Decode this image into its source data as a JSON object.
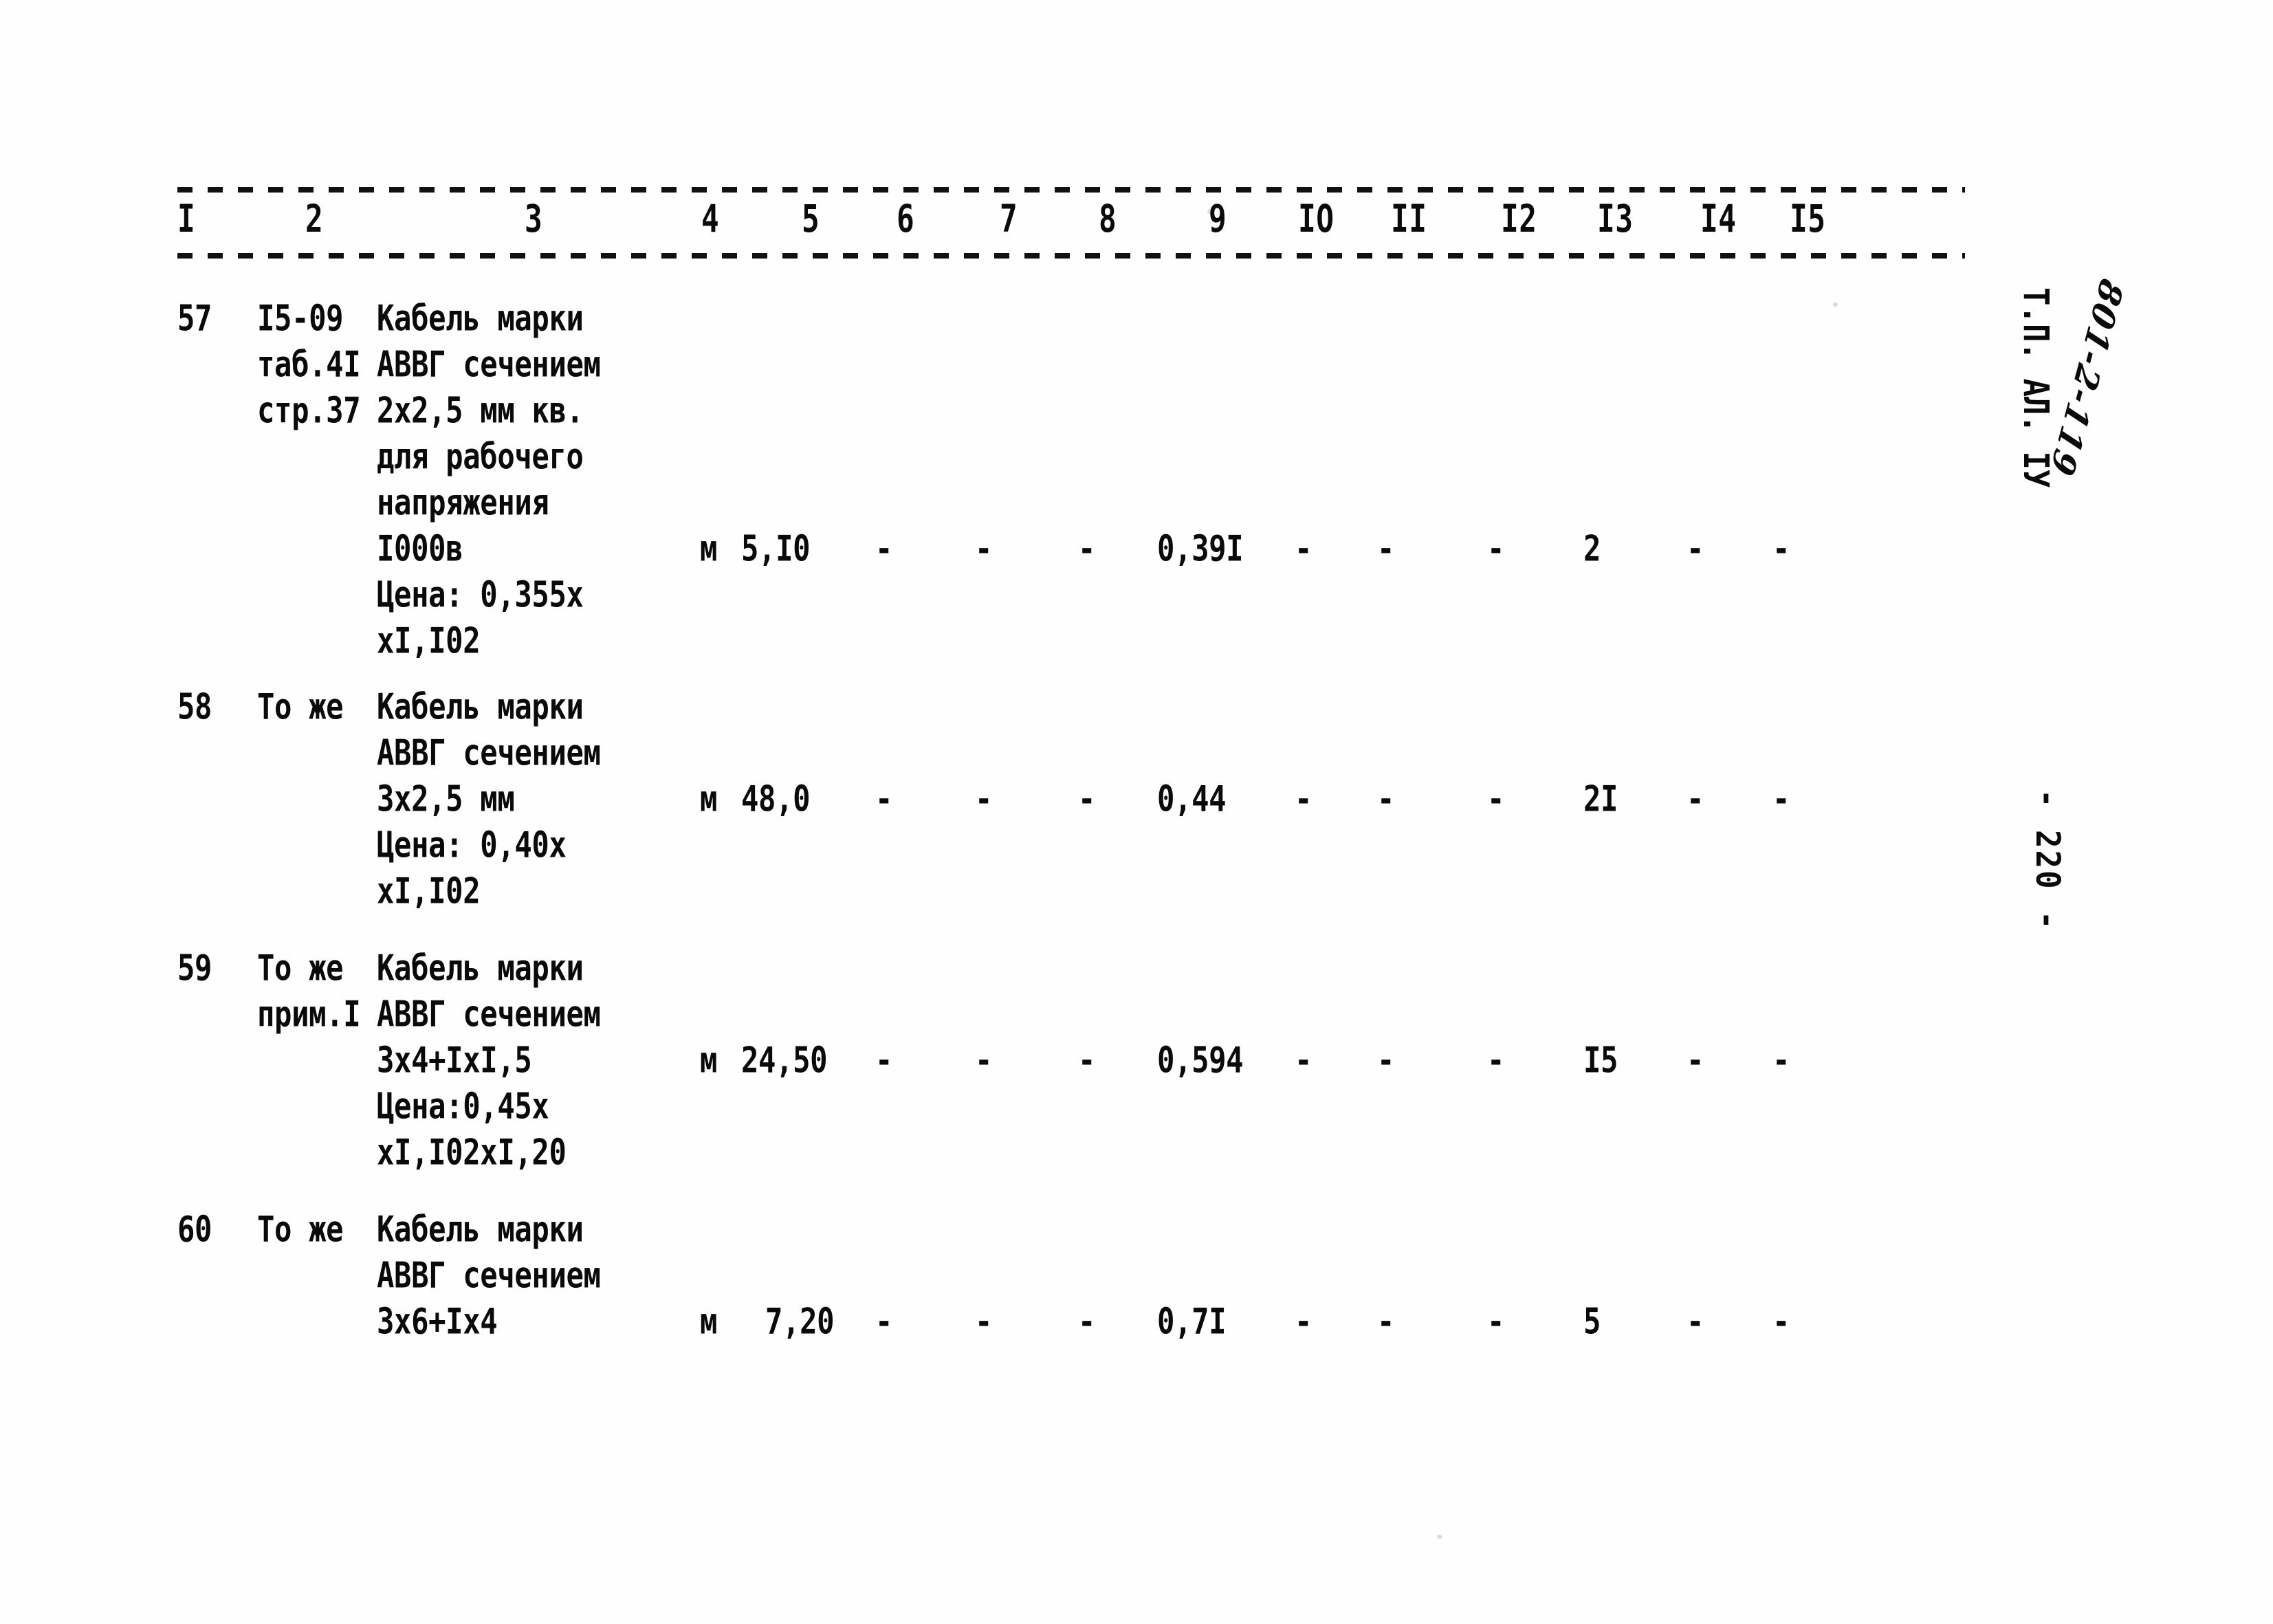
{
  "document": {
    "type": "scanned-estimate-table",
    "language": "ru",
    "ink_color": "#0a0a0a",
    "paper_color": "#fefefe"
  },
  "table": {
    "column_headers": [
      "I",
      "2",
      "3",
      "4",
      "5",
      "6",
      "7",
      "8",
      "9",
      "IO",
      "II",
      "I2",
      "I3",
      "I4",
      "I5"
    ],
    "rows": [
      {
        "num": "57",
        "ref_lines": [
          "I5-09",
          "таб.4I",
          "стр.37"
        ],
        "desc_lines": [
          "Кабель марки",
          "АВВГ сечением",
          "2х2,5 мм кв.",
          "для рабочего",
          "напряжения",
          "I000в",
          "Цена: 0,355х",
          "хI,I02"
        ],
        "value_line_index": 5,
        "unit": "м",
        "c5": "5,I0",
        "c6": "-",
        "c7": "-",
        "c8": "-",
        "c9": "0,39I",
        "c10": "-",
        "c11": "-",
        "c12": "-",
        "c13": "2",
        "c14": "-",
        "c15": "-"
      },
      {
        "num": "58",
        "ref_lines": [
          "То же"
        ],
        "desc_lines": [
          "Кабель марки",
          "АВВГ сечением",
          "3х2,5 мм",
          "Цена: 0,40х",
          "хI,I02"
        ],
        "value_line_index": 2,
        "unit": "м",
        "c5": "48,0",
        "c6": "-",
        "c7": "-",
        "c8": "-",
        "c9": "0,44",
        "c10": "-",
        "c11": "-",
        "c12": "-",
        "c13": "2I",
        "c14": "-",
        "c15": "-"
      },
      {
        "num": "59",
        "ref_lines": [
          "То же",
          "прим.I"
        ],
        "desc_lines": [
          "Кабель марки",
          "АВВГ сечением",
          "3х4+IхI,5",
          "Цена:0,45х",
          "хI,I02хI,20"
        ],
        "value_line_index": 2,
        "unit": "м",
        "c5": "24,50",
        "c6": "-",
        "c7": "-",
        "c8": "-",
        "c9": "0,594",
        "c10": "-",
        "c11": "-",
        "c12": "-",
        "c13": "I5",
        "c14": "-",
        "c15": "-"
      },
      {
        "num": "60",
        "ref_lines": [
          "То же"
        ],
        "desc_lines": [
          "Кабель марки",
          "АВВГ сечением",
          "3х6+Iх4"
        ],
        "value_line_index": 2,
        "unit": "м",
        "c5": "7,20",
        "c6": "-",
        "c7": "-",
        "c8": "-",
        "c9": "0,7I",
        "c10": "-",
        "c11": "-",
        "c12": "-",
        "c13": "5",
        "c14": "-",
        "c15": "-"
      }
    ]
  },
  "margin": {
    "typed_stamp": "Т.П. АЛ. IУ",
    "handwritten_stamp": "801-2-119",
    "page_number": "- 220 -"
  }
}
